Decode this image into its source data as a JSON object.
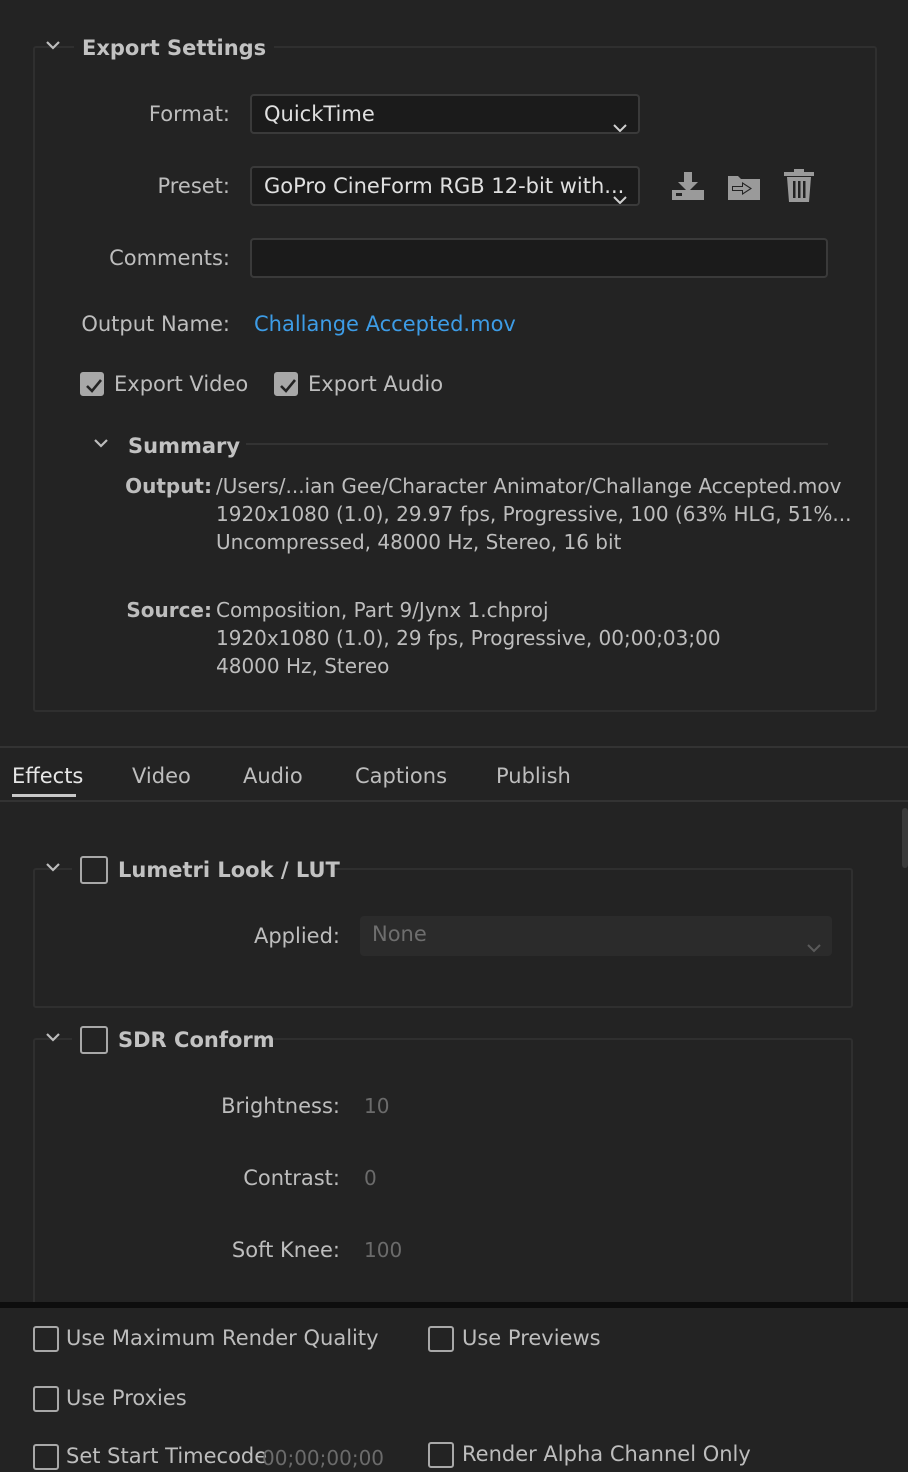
{
  "export_settings": {
    "title": "Export Settings",
    "format": {
      "label": "Format:",
      "value": "QuickTime"
    },
    "preset": {
      "label": "Preset:",
      "value": "GoPro CineForm RGB 12-bit with..."
    },
    "comments": {
      "label": "Comments:",
      "value": ""
    },
    "output_name": {
      "label": "Output Name:",
      "value": "Challange Accepted.mov"
    },
    "export_video": {
      "label": "Export Video",
      "checked": true
    },
    "export_audio": {
      "label": "Export Audio",
      "checked": true
    },
    "summary": {
      "title": "Summary",
      "output_label": "Output:",
      "output_lines": [
        "/Users/...ian Gee/Character Animator/Challange Accepted.mov",
        "1920x1080 (1.0), 29.97 fps, Progressive, 100 (63% HLG, 51%...",
        "Uncompressed, 48000 Hz, Stereo, 16 bit"
      ],
      "source_label": "Source:",
      "source_lines": [
        "Composition, Part 9/Jynx 1.chproj",
        "1920x1080 (1.0), 29 fps, Progressive, 00;00;03;00",
        "48000 Hz, Stereo"
      ]
    }
  },
  "tabs": [
    {
      "label": "Effects",
      "active": true
    },
    {
      "label": "Video",
      "active": false
    },
    {
      "label": "Audio",
      "active": false
    },
    {
      "label": "Captions",
      "active": false
    },
    {
      "label": "Publish",
      "active": false
    }
  ],
  "effects": {
    "lumetri": {
      "title": "Lumetri Look / LUT",
      "checked": false,
      "applied_label": "Applied:",
      "applied_value": "None"
    },
    "sdr": {
      "title": "SDR Conform",
      "checked": false,
      "brightness_label": "Brightness:",
      "brightness_value": "10",
      "contrast_label": "Contrast:",
      "contrast_value": "0",
      "soft_knee_label": "Soft Knee:",
      "soft_knee_value": "100"
    }
  },
  "footer": {
    "max_render_quality": {
      "label": "Use Maximum Render Quality",
      "checked": false
    },
    "use_previews": {
      "label": "Use Previews",
      "checked": false
    },
    "use_proxies": {
      "label": "Use Proxies",
      "checked": false
    },
    "set_start_timecode": {
      "label": "Set Start Timecode",
      "value": "00;00;00;00",
      "checked": false
    },
    "render_alpha": {
      "label": "Render Alpha Channel Only",
      "checked": false
    }
  },
  "colors": {
    "background": "#232323",
    "link": "#3d9ce6",
    "text": "#bdbdbd"
  },
  "icons": [
    "chevron-down-icon",
    "save-preset-icon",
    "import-preset-icon",
    "delete-preset-icon",
    "checkmark-icon"
  ]
}
